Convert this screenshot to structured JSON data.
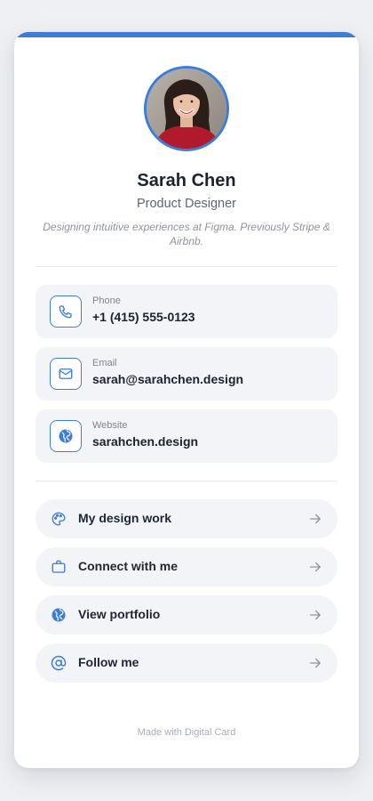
{
  "colors": {
    "accent": "#3b7dd8",
    "background": "#eef0f3",
    "card": "#ffffff",
    "tile": "#f2f4f7"
  },
  "profile": {
    "name": "Sarah Chen",
    "role": "Product Designer",
    "bio": "Designing intuitive experiences at Figma. Previously Stripe & Airbnb.",
    "avatar": "profile-photo"
  },
  "contacts": [
    {
      "label": "Phone",
      "value": "+1 (415) 555-0123",
      "icon": "phone-icon"
    },
    {
      "label": "Email",
      "value": "sarah@sarahchen.design",
      "icon": "mail-icon"
    },
    {
      "label": "Website",
      "value": "sarahchen.design",
      "icon": "globe-icon"
    }
  ],
  "links": [
    {
      "label": "My design work",
      "icon": "palette-icon"
    },
    {
      "label": "Connect with me",
      "icon": "briefcase-icon"
    },
    {
      "label": "View portfolio",
      "icon": "globe-icon"
    },
    {
      "label": "Follow me",
      "icon": "at-sign-icon"
    }
  ],
  "footer": {
    "text": "Made with Digital Card"
  }
}
